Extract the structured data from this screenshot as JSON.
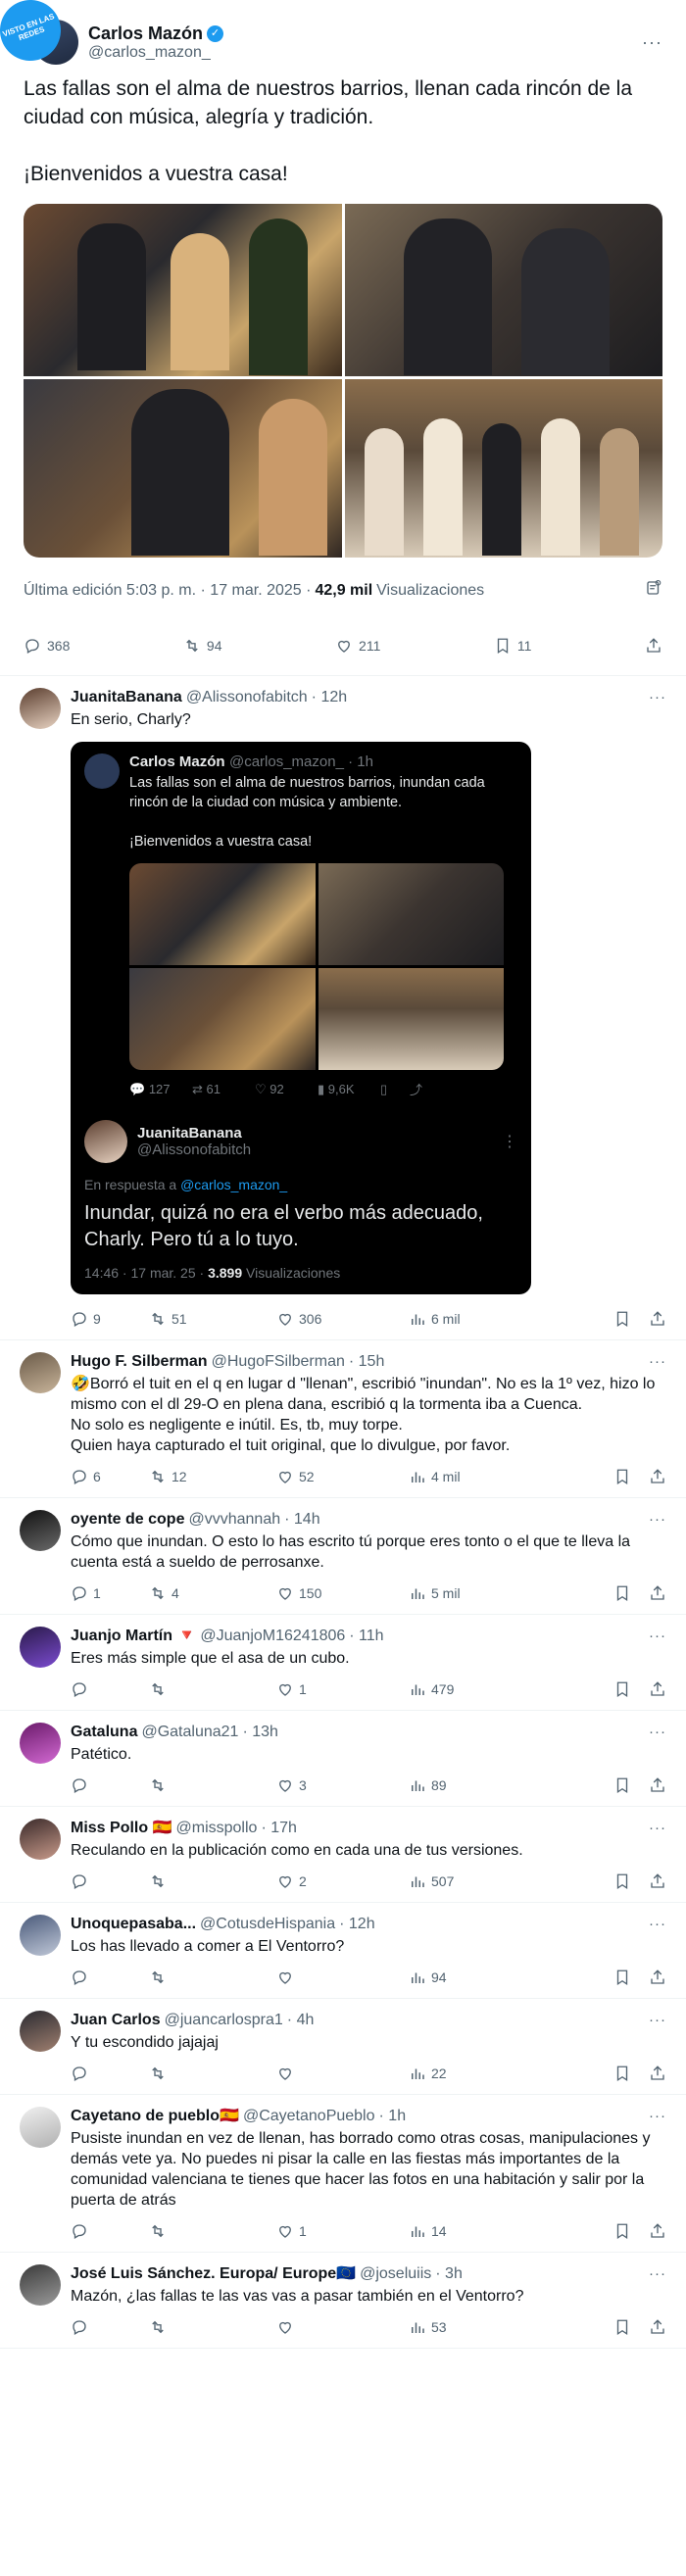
{
  "watermark": "VISTO EN LAS REDES",
  "main_tweet": {
    "name": "Carlos Mazón",
    "handle": "@carlos_mazon_",
    "text": "Las fallas son el alma de nuestros barrios, llenan cada rincón de la ciudad con música, alegría y tradición.\n\n¡Bienvenidos a vuestra casa!",
    "edited": "Última edición 5:03 p. m. · 17 mar. 2025 · ",
    "views": "42,9 mil",
    "views_label": "Visualizaciones",
    "stats": {
      "replies": "368",
      "retweets": "94",
      "likes": "211",
      "bookmarks": "11"
    }
  },
  "replies": [
    {
      "name": "JuanitaBanana",
      "handle": "@Alissonofabitch",
      "time": "· 12h",
      "text": "En serio, Charly?",
      "quote": {
        "name": "Carlos Mazón",
        "handle": "@carlos_mazon_ · 1h",
        "text": "Las fallas son el alma de nuestros barrios, inundan cada rincón de la ciudad con música y ambiente.\n\n¡Bienvenidos a vuestra casa!",
        "stats": [
          "127",
          "61",
          "92",
          "9,6K"
        ],
        "reply_name": "JuanitaBanana",
        "reply_handle": "@Alissonofabitch",
        "in_reply_label": "En respuesta a ",
        "in_reply_to": "@carlos_mazon_",
        "reply_text": "Inundar, quizá no era el verbo más adecuado, Charly. Pero tú a lo tuyo.",
        "meta": "14:46 · 17 mar. 25 · ",
        "meta_views": "3.899",
        "meta_views_label": " Visualizaciones"
      },
      "replies": "9",
      "retweets": "51",
      "likes": "306",
      "views": "6 mil"
    },
    {
      "name": "Hugo F. Silberman",
      "handle": "@HugoFSilberman",
      "time": "· 15h",
      "text": "🤣Borró el tuit en el q en lugar d \"llenan\", escribió \"inundan\". No es la 1º vez, hizo lo mismo con el dl 29-O en plena dana, escribió q la tormenta iba a Cuenca.\nNo solo es negligente e inútil. Es, tb, muy torpe.\nQuien haya capturado el tuit original, que lo divulgue, por favor.",
      "replies": "6",
      "retweets": "12",
      "likes": "52",
      "views": "4 mil"
    },
    {
      "name": "oyente de cope",
      "handle": "@vvvhannah",
      "time": "· 14h",
      "text": "Cómo que inundan. O esto lo has escrito tú porque eres tonto o el que te lleva la cuenta está a sueldo de perrosanxe.",
      "replies": "1",
      "retweets": "4",
      "likes": "150",
      "views": "5 mil"
    },
    {
      "name": "Juanjo Martín 🔻",
      "handle": "@JuanjoM16241806",
      "time": "· 11h",
      "text": "Eres más simple que el asa de un cubo.",
      "replies": "",
      "retweets": "",
      "likes": "1",
      "views": "479"
    },
    {
      "name": "Gataluna",
      "handle": "@Gataluna21",
      "time": "· 13h",
      "text": "Patético.",
      "replies": "",
      "retweets": "",
      "likes": "3",
      "views": "89"
    },
    {
      "name": "Miss Pollo 🇪🇸",
      "handle": "@misspollo",
      "time": "· 17h",
      "text": "Reculando en la publicación como en cada una de tus versiones.",
      "replies": "",
      "retweets": "",
      "likes": "2",
      "views": "507"
    },
    {
      "name": "Unoquepasaba...",
      "handle": "@CotusdeHispania",
      "time": "· 12h",
      "text": "Los has llevado a comer a El Ventorro?",
      "replies": "",
      "retweets": "",
      "likes": "",
      "views": "94"
    },
    {
      "name": "Juan Carlos",
      "handle": "@juancarlospra1",
      "time": "· 4h",
      "text": "Y tu escondido jajajaj",
      "replies": "",
      "retweets": "",
      "likes": "",
      "views": "22"
    },
    {
      "name": "Cayetano de pueblo🇪🇸",
      "handle": "@CayetanoPueblo",
      "time": "· 1h",
      "text": "Pusiste inundan en vez de llenan, has borrado como otras cosas, manipulaciones y demás vete ya. No puedes ni pisar la calle en las fiestas más importantes de la comunidad valenciana te tienes que hacer las fotos en una habitación y salir por la puerta de atrás",
      "replies": "",
      "retweets": "",
      "likes": "1",
      "views": "14"
    },
    {
      "name": "José Luis Sánchez. Europa/ Europe🇪🇺",
      "handle": "@joseluiis",
      "time": "· 3h",
      "text": "Mazón, ¿las fallas te las vas vas a pasar también en el Ventorro?",
      "replies": "",
      "retweets": "",
      "likes": "",
      "views": "53"
    }
  ],
  "colors": {
    "accent": "#1d9bf0",
    "muted": "#536471",
    "quote_bg": "#000000"
  }
}
